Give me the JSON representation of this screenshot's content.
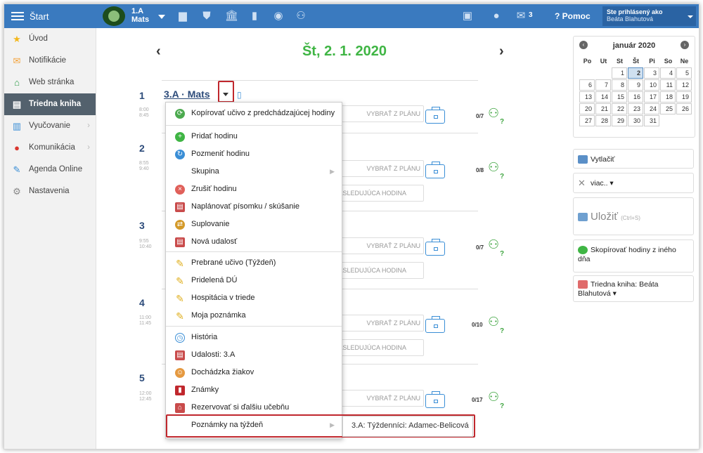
{
  "topbar": {
    "start_label": "Štart",
    "class_name": "1.A",
    "class_sub": "Mats",
    "mail_count": "3",
    "help_label": "? Pomoc",
    "logged_label": "Ste prihlásený ako",
    "logged_user": "Beáta Blahutová"
  },
  "sidebar": {
    "items": [
      {
        "label": "Úvod"
      },
      {
        "label": "Notifikácie"
      },
      {
        "label": "Web stránka"
      },
      {
        "label": "Triedna kniha"
      },
      {
        "label": "Vyučovanie"
      },
      {
        "label": "Komunikácia"
      },
      {
        "label": "Agenda Online"
      },
      {
        "label": "Nastavenia"
      }
    ]
  },
  "main": {
    "date": "Št, 2. 1. 2020",
    "prev": "‹",
    "next": "›",
    "lesson1_name": "3.A · Mats",
    "periods": [
      {
        "num": "1",
        "from": "8:00",
        "to": "8:45",
        "att": "0/7"
      },
      {
        "num": "2",
        "from": "8:55",
        "to": "9:40",
        "att": "0/8"
      },
      {
        "num": "3",
        "from": "9:55",
        "to": "10:40",
        "att": "0/7"
      },
      {
        "num": "4",
        "from": "11:00",
        "to": "11:45",
        "att": "0/10"
      },
      {
        "num": "5",
        "from": "12:00",
        "to": "12:45",
        "att": "0/17"
      }
    ],
    "select_plan": "VYBRAŤ Z PLÁNU",
    "next_lesson": "NASLEDUJÚCA HODINA"
  },
  "menu": {
    "items": [
      "Kopírovať učivo z predchádzajúcej hodiny",
      "Pridať hodinu",
      "Pozmeniť hodinu",
      "Skupina",
      "Zrušiť hodinu",
      "Naplánovať písomku / skúšanie",
      "Suplovanie",
      "Nová udalosť",
      "Prebrané učivo (Týždeň)",
      "Pridelená DÚ",
      "Hospitácia v triede",
      "Moja poznámka",
      "História",
      "Udalosti: 3.A",
      "Dochádzka žiakov",
      "Známky",
      "Rezervovať si ďalšiu učebňu",
      "Poznámky na týždeň"
    ],
    "submenu_item": "3.A: Týždenníci: Adamec-Belicová"
  },
  "calendar": {
    "month": "január 2020",
    "dow": [
      "Po",
      "Ut",
      "St",
      "Št",
      "Pi",
      "So",
      "Ne"
    ],
    "weeks": [
      [
        "",
        "",
        "1",
        "2",
        "3",
        "4",
        "5"
      ],
      [
        "6",
        "7",
        "8",
        "9",
        "10",
        "11",
        "12"
      ],
      [
        "13",
        "14",
        "15",
        "16",
        "17",
        "18",
        "19"
      ],
      [
        "20",
        "21",
        "22",
        "23",
        "24",
        "25",
        "26"
      ],
      [
        "27",
        "28",
        "29",
        "30",
        "31",
        "",
        ""
      ]
    ],
    "today": "2"
  },
  "right": {
    "print": "Vytlačiť",
    "more": "viac.. ▾",
    "save": "Uložiť",
    "save_shortcut": "(Ctrl+S)",
    "copy_hours": "Skopírovať hodiny z iného dňa",
    "class_book": "Triedna kniha: Beáta Blahutová ▾"
  }
}
